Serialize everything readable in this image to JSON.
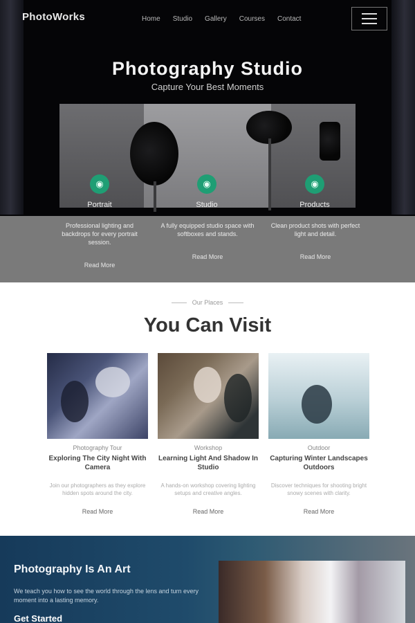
{
  "hero": {
    "logo": "PhotoWorks",
    "nav": [
      "Home",
      "Studio",
      "Gallery",
      "Courses",
      "Contact"
    ],
    "title": "Photography Studio",
    "subtitle": "Capture Your Best Moments",
    "features": [
      {
        "label": "Portrait",
        "desc": "Professional lighting and backdrops for every portrait session.",
        "more": "Read More"
      },
      {
        "label": "Studio",
        "desc": "A fully equipped studio space with softboxes and stands.",
        "more": "Read More"
      },
      {
        "label": "Products",
        "desc": "Clean product shots with perfect light and detail.",
        "more": "Read More"
      }
    ]
  },
  "visit": {
    "eyebrow": "Our Places",
    "title": "You Can Visit",
    "cards": [
      {
        "meta": "Photography Tour",
        "title": "Exploring The City Night With Camera",
        "excerpt": "Join our photographers as they explore hidden spots around the city.",
        "read": "Read More"
      },
      {
        "meta": "Workshop",
        "title": "Learning Light And Shadow In Studio",
        "excerpt": "A hands-on workshop covering lighting setups and creative angles.",
        "read": "Read More"
      },
      {
        "meta": "Outdoor",
        "title": "Capturing Winter Landscapes Outdoors",
        "excerpt": "Discover techniques for shooting bright snowy scenes with clarity.",
        "read": "Read More"
      }
    ]
  },
  "banner": {
    "title": "Photography Is An Art",
    "text": "We teach you how to see the world through the lens and turn every moment into a lasting memory.",
    "cta": "Get Started"
  },
  "colors": {
    "accent": "#1f9e74",
    "banner": "#1f4b6b",
    "hero_band": "#7a7a7a"
  },
  "icons": {
    "feature_icon": "camera-icon",
    "menu_icon": "hamburger-icon"
  }
}
